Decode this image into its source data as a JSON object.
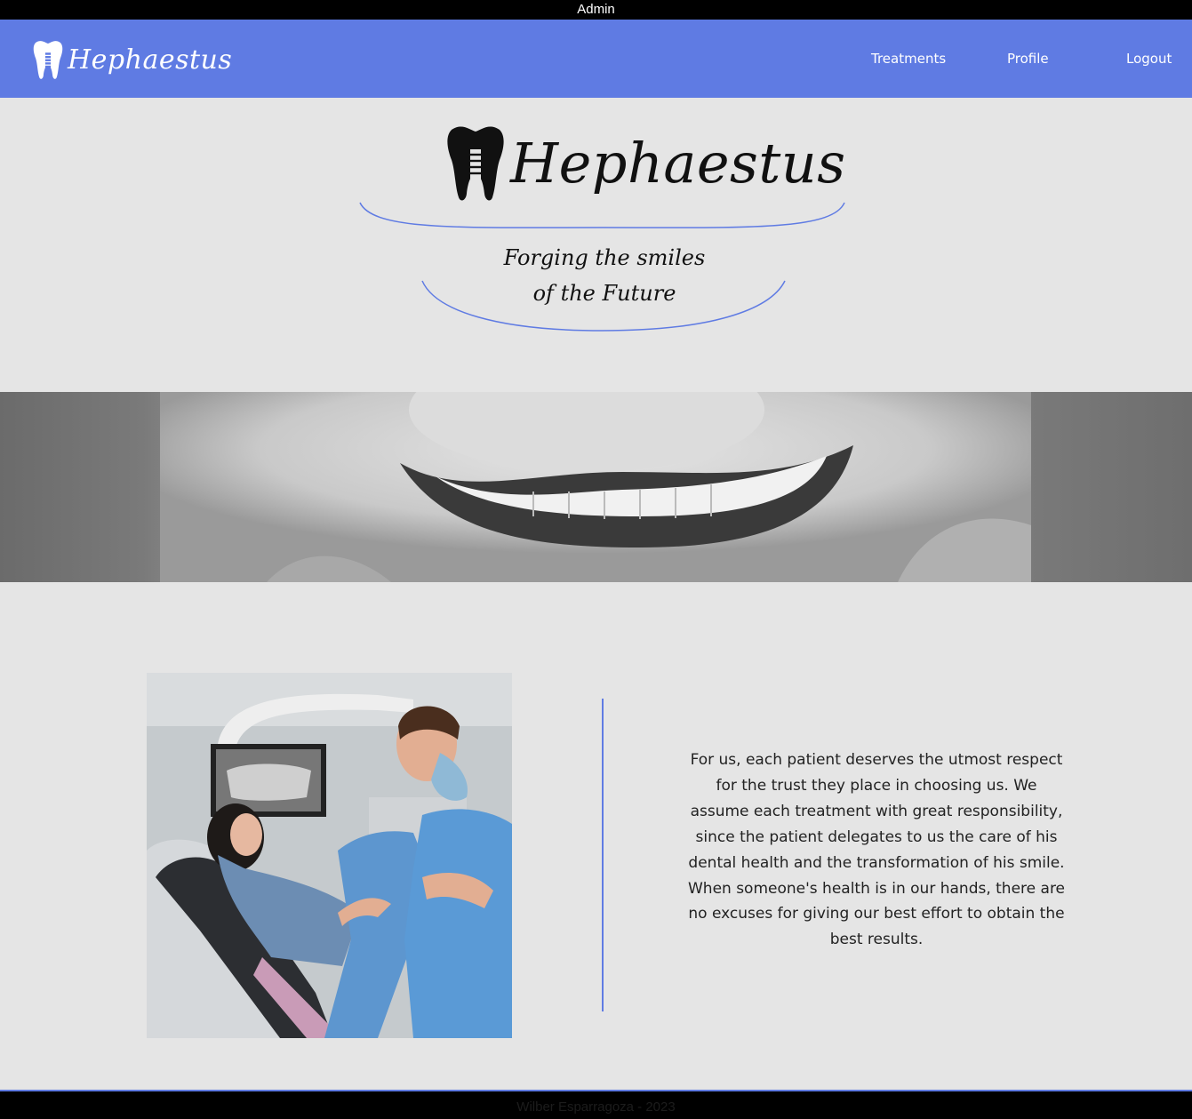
{
  "admin_bar": {
    "label": "Admin"
  },
  "navbar": {
    "brand": {
      "name": "Hephaestus",
      "icon": "tooth-icon"
    },
    "links": [
      {
        "label": "Treatments"
      },
      {
        "label": "Profile"
      },
      {
        "label": "Logout"
      }
    ],
    "color": "#5f7be3"
  },
  "hero": {
    "logo_name": "Hephaestus",
    "icon": "tooth-icon",
    "tagline_line1": "Forging the smiles",
    "tagline_line2": "of the Future",
    "arc_color": "#5f7be3"
  },
  "banner": {
    "image": "smiling-child-closeup"
  },
  "content": {
    "photo": "dentist-talking-with-patient",
    "mission_text": "For us, each patient deserves the utmost respect for the trust they place in choosing us. We assume each treatment with great responsibility, since the patient delegates to us the care of his dental health and the transformation of his smile. When someone's health is in our hands, there are no excuses for giving our best effort to obtain the best results."
  },
  "footer": {
    "text": "Wilber Esparragoza - 2023"
  }
}
